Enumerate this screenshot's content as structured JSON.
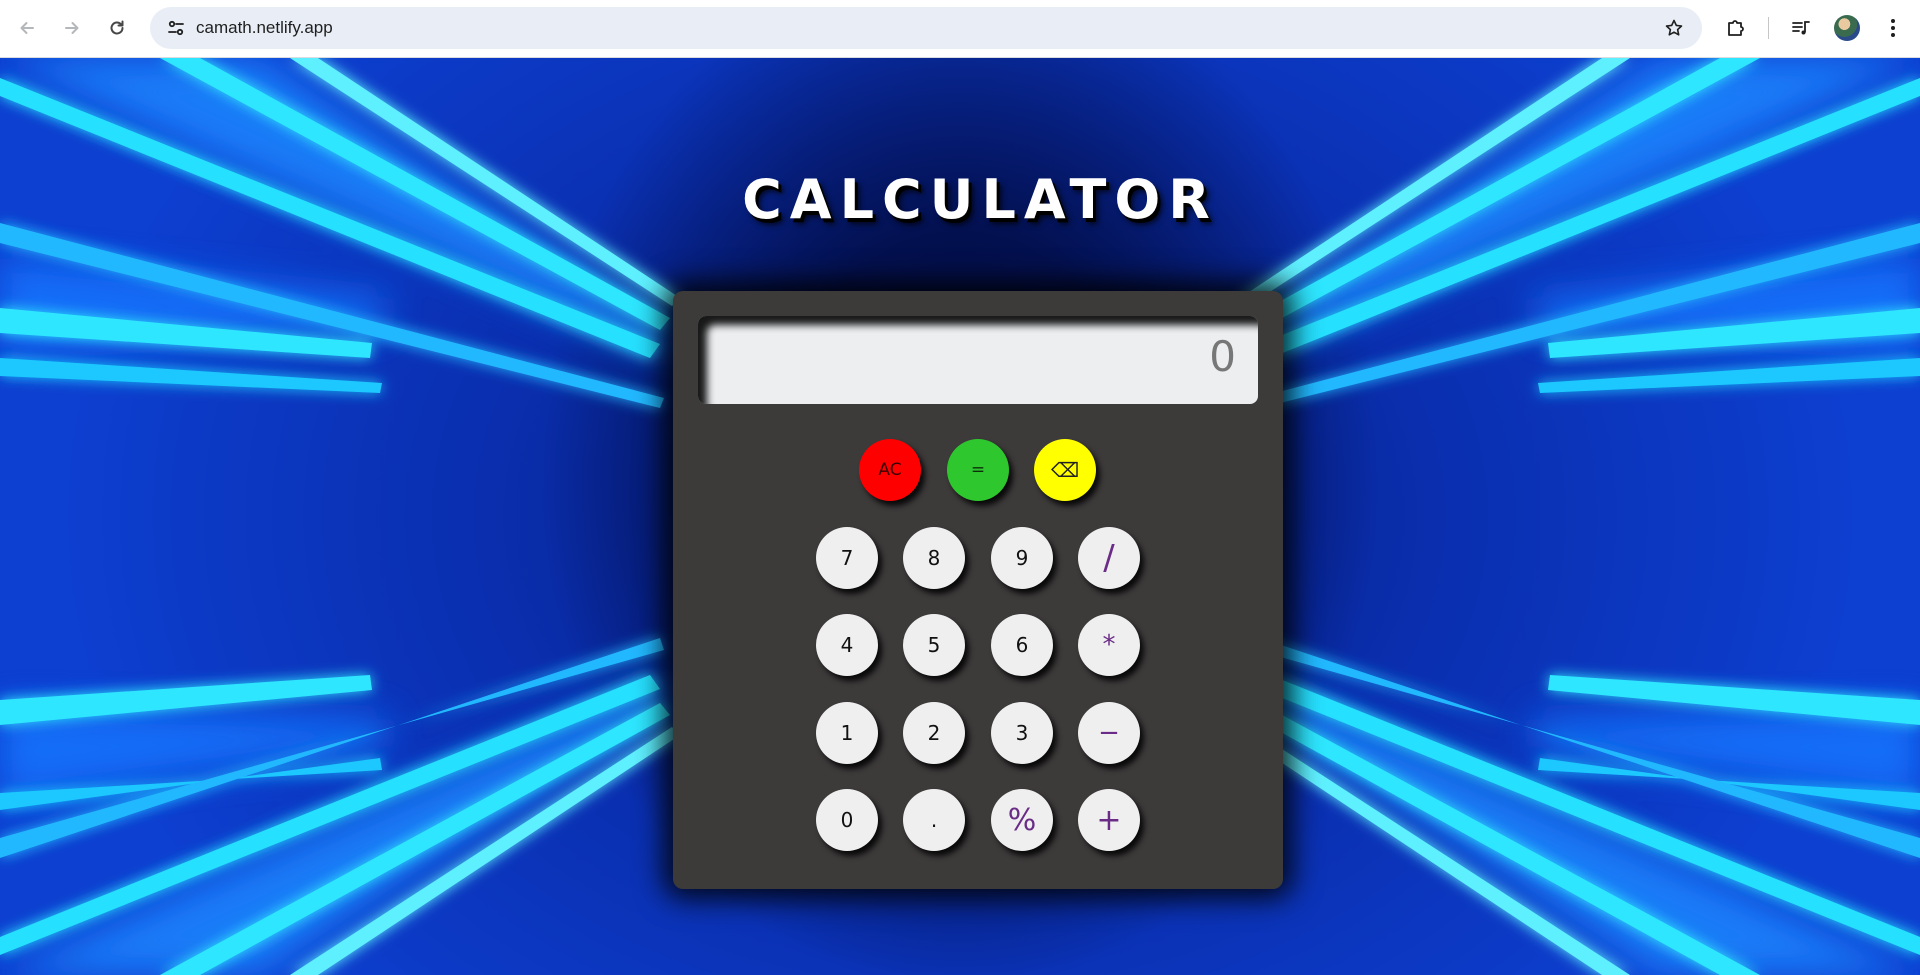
{
  "browser": {
    "url": "camath.netlify.app",
    "back_icon": "arrow-left-icon",
    "forward_icon": "arrow-right-icon",
    "reload_icon": "reload-icon",
    "site_info_icon": "tune-icon",
    "bookmark_icon": "star-icon",
    "extensions_icon": "puzzle-icon",
    "media_icon": "queue-music-icon",
    "menu_icon": "kebab-menu-icon"
  },
  "page": {
    "title": "CALCULATOR",
    "display": {
      "value": "0"
    },
    "control_keys": [
      {
        "label": "AC",
        "name": "clear-button",
        "color": "#ff0000"
      },
      {
        "label": "=",
        "name": "equals-button",
        "color": "#2ec72e"
      },
      {
        "label": "⌫",
        "name": "backspace-button",
        "color": "#ffff00"
      }
    ],
    "keys": [
      {
        "label": "7",
        "kind": "num",
        "name": "key-7"
      },
      {
        "label": "8",
        "kind": "num",
        "name": "key-8"
      },
      {
        "label": "9",
        "kind": "num",
        "name": "key-9"
      },
      {
        "label": "/",
        "kind": "op",
        "name": "key-divide"
      },
      {
        "label": "4",
        "kind": "num",
        "name": "key-4"
      },
      {
        "label": "5",
        "kind": "num",
        "name": "key-5"
      },
      {
        "label": "6",
        "kind": "num",
        "name": "key-6"
      },
      {
        "label": "*",
        "kind": "op",
        "name": "key-multiply"
      },
      {
        "label": "1",
        "kind": "num",
        "name": "key-1"
      },
      {
        "label": "2",
        "kind": "num",
        "name": "key-2"
      },
      {
        "label": "3",
        "kind": "num",
        "name": "key-3"
      },
      {
        "label": "−",
        "kind": "op",
        "name": "key-subtract"
      },
      {
        "label": "0",
        "kind": "num",
        "name": "key-0"
      },
      {
        "label": ".",
        "kind": "num",
        "name": "key-decimal"
      },
      {
        "label": "%",
        "kind": "op",
        "name": "key-percent"
      },
      {
        "label": "+",
        "kind": "op",
        "name": "key-add"
      }
    ]
  },
  "colors": {
    "accent_operator": "#6a2c86",
    "calculator_body": "#3d3a3a",
    "background_deep": "#03104f",
    "beam": "#22d8ff"
  }
}
